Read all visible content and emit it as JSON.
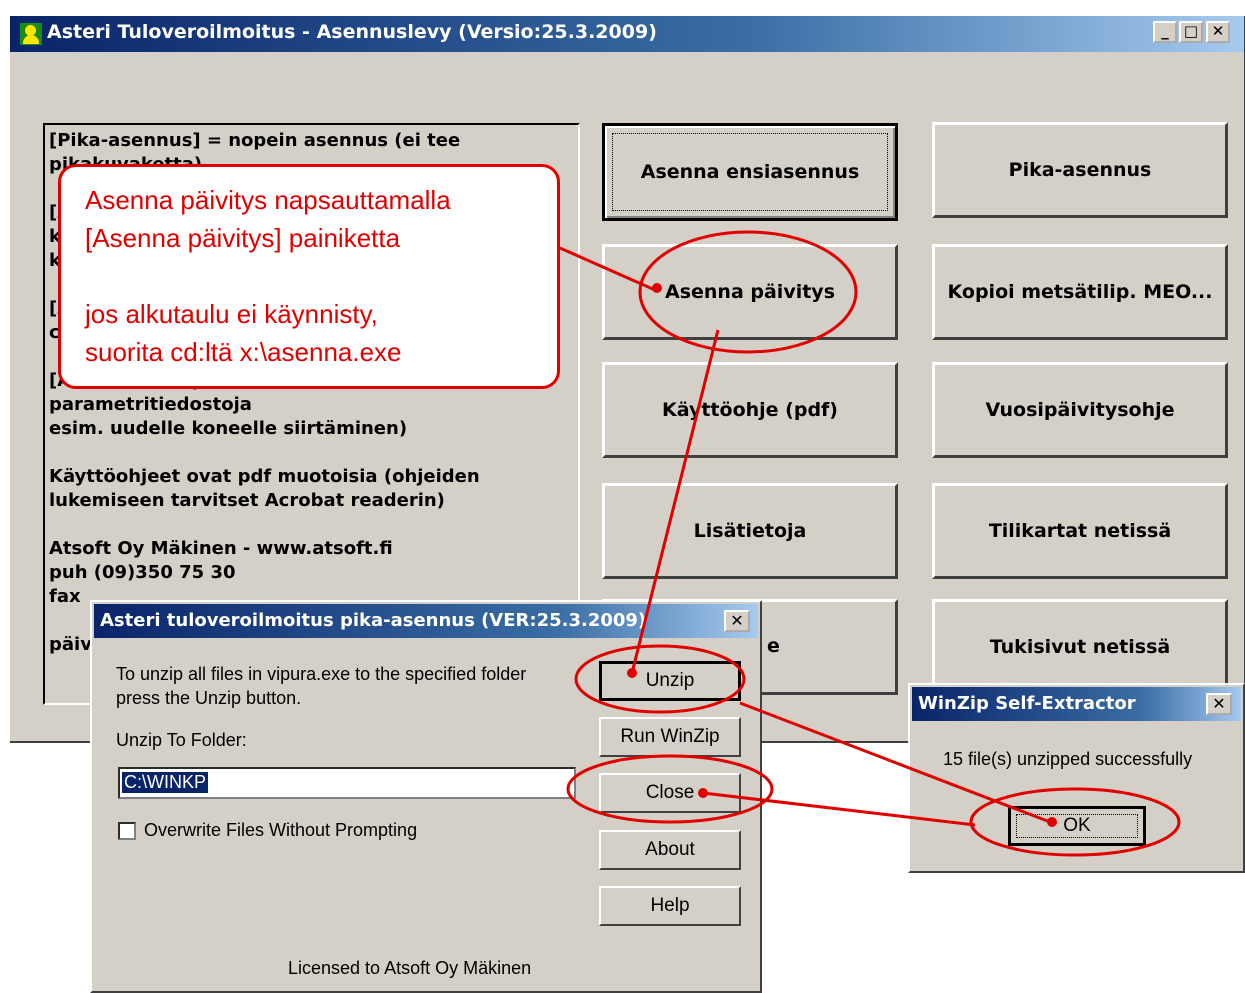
{
  "main_window": {
    "title": "Asteri Tuloveroilmoitus - Asennuslevy (Versio:25.3.2009)",
    "minimize_icon": "minimize-icon",
    "maximize_icon": "maximize-icon",
    "close_icon": "close-icon",
    "info_lines": [
      "[Pika-asennus] = nopein asennus (ei tee",
      "pikakuvaketta)",
      "[A",
      "k",
      "k",
      "[A",
      "c",
      "[Asenna lisää parametrit] = siirrettävät lisää",
      "parametritiedostoja",
      "esim. uudelle koneelle siirtäminen)",
      "Käyttöohjeet ovat pdf muotoisia (ohjeiden",
      "lukemiseen tarvitset Acrobat readerin)",
      "Atsoft Oy Mäkinen - www.atsoft.fi",
      "puh (09)350 75 30",
      "fax",
      "päiv"
    ],
    "buttons": {
      "asenna_ensiasennus": "Asenna ensiasennus",
      "pika_asennus": "Pika-asennus",
      "asenna_paivitys": "Asenna päivitys",
      "kopioi": "Kopioi metsätilip. MEO...",
      "kayttoohje": "Käyttöohje (pdf)",
      "vuosipaivitysohje": "Vuosipäivitysohje",
      "lisatietoja": "Lisätietoja",
      "tilikartat": "Tilikartat netissä",
      "hidden_left": "e",
      "tukisivut": "Tukisivut netissä"
    }
  },
  "callout": {
    "line1": "Asenna päivitys napsauttamalla",
    "line2": "[Asenna päivitys] painiketta",
    "line3": "jos alkutaulu ei käynnisty,",
    "line4": "suorita cd:ltä x:\\asenna.exe"
  },
  "pika_dialog": {
    "title": "Asteri tuloveroilmoitus pika-asennus (VER:25.3.2009)",
    "close_label": "X",
    "instruction_line1": "To unzip all files in vipura.exe to the specified folder",
    "instruction_line2": "press the Unzip button.",
    "folder_label": "Unzip To Folder:",
    "folder_value": "C:\\WINKP",
    "overwrite_label": "Overwrite Files Without Prompting",
    "overwrite_checked": false,
    "buttons": {
      "unzip": "Unzip",
      "run_winzip": "Run WinZip",
      "close": "Close",
      "about": "About",
      "help": "Help"
    },
    "license": "Licensed to Atsoft Oy Mäkinen"
  },
  "winzip_dialog": {
    "title": "WinZip Self-Extractor",
    "close_label": "X",
    "message": "15 file(s) unzipped successfully",
    "ok": "OK"
  },
  "colors": {
    "annotation": "#e00000",
    "titlebar": "#0a246a",
    "face": "#d4d0c8"
  }
}
